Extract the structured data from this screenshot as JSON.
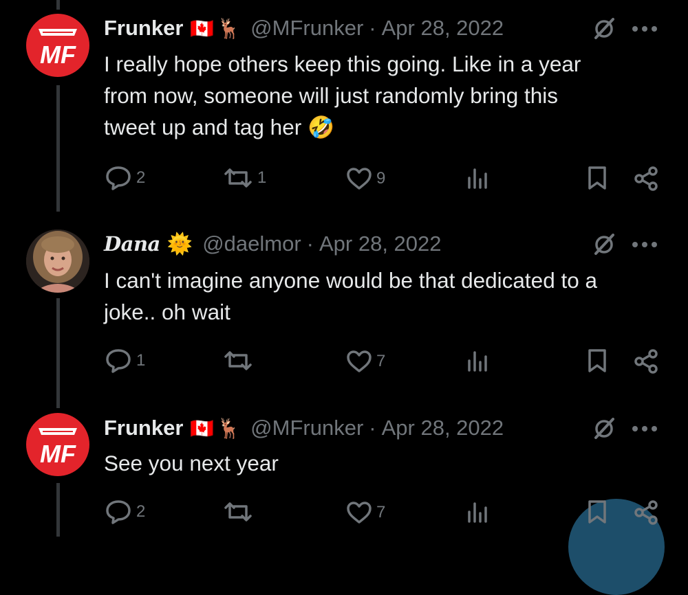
{
  "tweets": [
    {
      "name": "Frunker",
      "flag_emoji": "🇨🇦",
      "deer_emoji": "🦌",
      "handle": "@MFrunker",
      "separator": "·",
      "date": "Apr 28, 2022",
      "avatar_text": "MF",
      "text_lines": [
        "I really hope others keep this going. Like in a year",
        "from now, someone will just randomly bring this",
        "tweet up and tag her"
      ],
      "trailing_emoji": "🤣",
      "reply_count": "2",
      "retweet_count": "1",
      "like_count": "9"
    },
    {
      "name": "Dana",
      "sun_emoji": "🌞",
      "handle": "@daelmor",
      "separator": "·",
      "date": "Apr 28, 2022",
      "text_lines": [
        "I can't imagine anyone would be that dedicated to a",
        "joke.. oh wait"
      ],
      "reply_count": "1",
      "retweet_count": "",
      "like_count": "7"
    },
    {
      "name": "Frunker",
      "flag_emoji": "🇨🇦",
      "deer_emoji": "🦌",
      "handle": "@MFrunker",
      "separator": "·",
      "date": "Apr 28, 2022",
      "avatar_text": "MF",
      "text_lines": [
        "See you next year"
      ],
      "reply_count": "2",
      "retweet_count": "",
      "like_count": "7"
    }
  ],
  "colors": {
    "background": "#000000",
    "text": "#e7e9ea",
    "secondary": "#71767b",
    "avatar_red": "#e3242b",
    "fab": "#1d4e6a"
  }
}
